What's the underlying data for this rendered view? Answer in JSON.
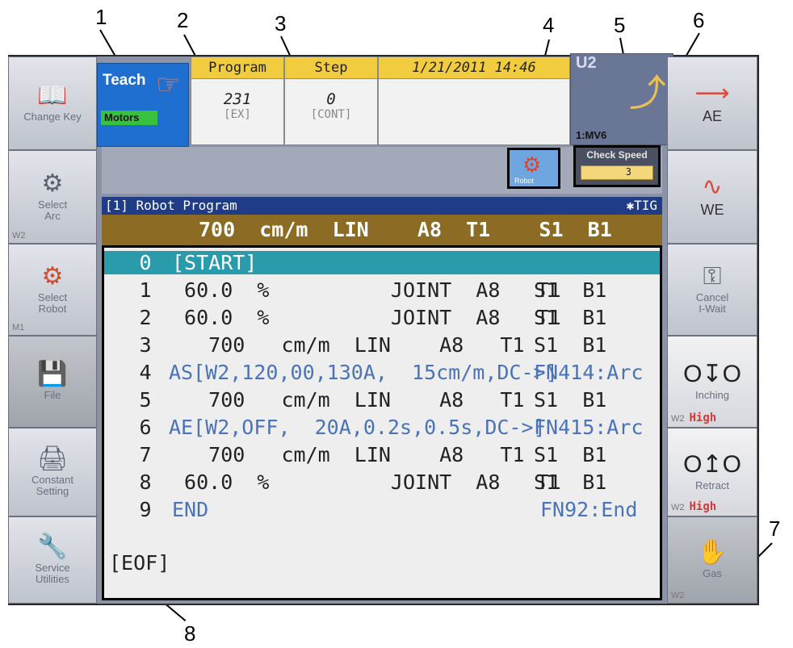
{
  "callouts": [
    "1",
    "2",
    "3",
    "4",
    "5",
    "6",
    "7",
    "8"
  ],
  "left_buttons": [
    {
      "label": "Change Key",
      "icon": "book-icon"
    },
    {
      "label": "Select\nArc",
      "sub": "W2",
      "icon": "torch-icon"
    },
    {
      "label": "Select\nRobot",
      "sub": "M1",
      "icon": "robot-icon"
    },
    {
      "label": "File",
      "icon": "floppy-disk-icon"
    },
    {
      "label": "Constant\nSetting",
      "icon": "settings-window-icon"
    },
    {
      "label": "Service\nUtilities",
      "icon": "wrench-icon"
    }
  ],
  "right_buttons": [
    {
      "label": "AE",
      "icon": "arc-end-icon"
    },
    {
      "label": "WE",
      "icon": "weave-icon"
    },
    {
      "label": "Cancel\nI-Wait",
      "icon": "key-icon"
    },
    {
      "label": "Inching",
      "sub": "W2",
      "level": "High",
      "icon": "inching-icon"
    },
    {
      "label": "Retract",
      "sub": "W2",
      "level": "High",
      "icon": "retract-icon"
    },
    {
      "label": "Gas",
      "sub": "W2",
      "icon": "gas-icon"
    }
  ],
  "status": {
    "mode": "Teach",
    "motors": "Motors",
    "program_label": "Program",
    "program_value": "231",
    "program_tag": "[EX]",
    "step_label": "Step",
    "step_value": "0",
    "step_tag": "[CONT]",
    "datetime": "1/21/2011  14:46",
    "unit": "U2",
    "mechanism": "1:MV6",
    "robot_button_label": "Robot",
    "check_speed_label": "Check Speed",
    "check_speed_value": "3"
  },
  "program": {
    "title": "[1] Robot Program",
    "process": "✱TIG",
    "command": "700  cm/m  LIN    A8  T1    S1  B1",
    "lines": [
      {
        "no": "0",
        "text": "[START]",
        "right": "",
        "arc": false,
        "selected": true
      },
      {
        "no": "1",
        "text": " 60.0  %          JOINT  A8   T1",
        "right": "S1  B1",
        "arc": false
      },
      {
        "no": "2",
        "text": " 60.0  %          JOINT  A8   T1",
        "right": "S1  B1",
        "arc": false
      },
      {
        "no": "3",
        "text": "   700   cm/m  LIN    A8   T1",
        "right": "S1  B1",
        "arc": false
      },
      {
        "no": "4",
        "text": "AS[W2,120,00,130A,  15cm/m,DC->]",
        "right": "FN414:Arc",
        "arc": true
      },
      {
        "no": "5",
        "text": "   700   cm/m  LIN    A8   T1",
        "right": "S1  B1",
        "arc": false
      },
      {
        "no": "6",
        "text": "AE[W2,OFF,  20A,0.2s,0.5s,DC->]",
        "right": "FN415:Arc",
        "arc": true
      },
      {
        "no": "7",
        "text": "   700   cm/m  LIN    A8   T1",
        "right": "S1  B1",
        "arc": false
      },
      {
        "no": "8",
        "text": " 60.0  %          JOINT  A8   T1",
        "right": "S1  B1",
        "arc": false
      },
      {
        "no": "9",
        "text": "END",
        "right": "FN92:End",
        "arc": true
      }
    ],
    "eof": "[EOF]"
  }
}
